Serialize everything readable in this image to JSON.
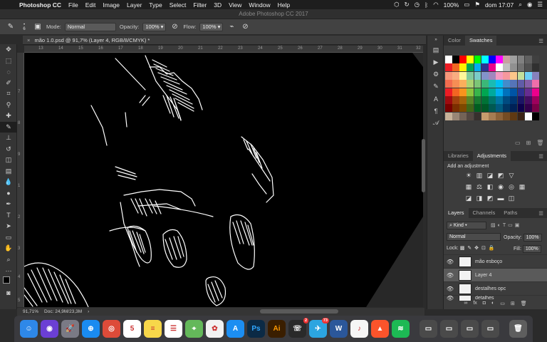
{
  "menubar": {
    "app_name": "Photoshop CC",
    "items": [
      "File",
      "Edit",
      "Image",
      "Layer",
      "Type",
      "Select",
      "Filter",
      "3D",
      "View",
      "Window",
      "Help"
    ],
    "battery": "100%",
    "clock": "dom 17:07"
  },
  "window_title": "Adobe Photoshop CC 2017",
  "options": {
    "brush_size": "6",
    "mode_label": "Mode:",
    "mode_value": "Normal",
    "opacity_label": "Opacity:",
    "opacity_value": "100%",
    "flow_label": "Flow:",
    "flow_value": "100%"
  },
  "document": {
    "tab_title": "mão 1.0.psd @ 91,7% (Layer 4, RGB/8/CMYK) *",
    "zoom": "91,71%",
    "doc_info": "Doc: 24,9M/23,3M"
  },
  "ruler": {
    "top": [
      "13",
      "14",
      "15",
      "16",
      "17",
      "18",
      "19",
      "20",
      "21",
      "22",
      "23",
      "24",
      "25",
      "26",
      "27",
      "28",
      "29",
      "30",
      "31",
      "32"
    ],
    "left": [
      "7",
      "8",
      "9",
      "1",
      "2",
      "3",
      "4",
      "5"
    ]
  },
  "panels": {
    "color_tabs": [
      "Color",
      "Swatches"
    ],
    "adjust_tabs": [
      "Libraries",
      "Adjustments"
    ],
    "adjust_title": "Add an adjustment",
    "layer_tabs": [
      "Layers",
      "Channels",
      "Paths"
    ],
    "kind_label": "Kind",
    "blend_mode": "Normal",
    "opacity_label": "Opacity:",
    "opacity_value": "100%",
    "lock_label": "Lock:",
    "fill_label": "Fill:",
    "fill_value": "100%",
    "layers": [
      {
        "name": "mão esboço",
        "selected": false
      },
      {
        "name": "Layer 4",
        "selected": true
      },
      {
        "name": "destalhes opc",
        "selected": false
      },
      {
        "name": "detalhes",
        "selected": false
      }
    ]
  },
  "swatches": [
    [
      "#ffffff",
      "#000000",
      "#ff0000",
      "#ffff00",
      "#00ff00",
      "#00ffff",
      "#0000ff",
      "#ff00ff",
      "#c8a0a0",
      "#a0a0a0",
      "#808080",
      "#606060",
      "#404040"
    ],
    [
      "#ed1c24",
      "#f26522",
      "#fff200",
      "#00a651",
      "#00aeef",
      "#2e3192",
      "#ec008c",
      "#ffffff",
      "#c0c0c0",
      "#909090",
      "#707070",
      "#505050",
      "#303030"
    ],
    [
      "#f7977a",
      "#f9ad81",
      "#fff79a",
      "#82ca9d",
      "#7accc8",
      "#8393ca",
      "#a187be",
      "#f49ac2",
      "#f6989d",
      "#fdc68a",
      "#c4df9b",
      "#6ecff6",
      "#8781bd"
    ],
    [
      "#f26c4f",
      "#f68e55",
      "#fbaf5c",
      "#acd372",
      "#7cc576",
      "#3bb878",
      "#1abbb4",
      "#00bff3",
      "#438ccb",
      "#5574b9",
      "#605ca8",
      "#855fa8",
      "#f06eaa"
    ],
    [
      "#ed1c24",
      "#f26522",
      "#f7941d",
      "#8dc63f",
      "#39b54a",
      "#00a651",
      "#00a99d",
      "#00aeef",
      "#0072bc",
      "#0054a6",
      "#2e3192",
      "#662d91",
      "#ec008c"
    ],
    [
      "#9e0b0f",
      "#a0410d",
      "#a3620a",
      "#598527",
      "#197b30",
      "#007236",
      "#00746b",
      "#0076a3",
      "#004b80",
      "#003471",
      "#1b1464",
      "#440e62",
      "#9e005d"
    ],
    [
      "#790000",
      "#7b2e00",
      "#7d4900",
      "#406618",
      "#005e20",
      "#005826",
      "#005952",
      "#005b7f",
      "#003663",
      "#002157",
      "#0d004c",
      "#32004b",
      "#7b0046"
    ],
    [
      "#c7b299",
      "#998675",
      "#736357",
      "#534741",
      "#37302d",
      "#c69c6d",
      "#a67c52",
      "#8c6239",
      "#754c24",
      "#603913",
      "#3c2415",
      "#ffffff",
      "#000000"
    ]
  ],
  "dock": {
    "apps": [
      {
        "name": "finder",
        "label": "☺",
        "color": "#2e88e8"
      },
      {
        "name": "siri",
        "label": "◉",
        "color": "#6b3fd4"
      },
      {
        "name": "launchpad",
        "label": "🚀",
        "color": "#7a7a85"
      },
      {
        "name": "safari",
        "label": "⊕",
        "color": "#1a8bf0"
      },
      {
        "name": "chrome",
        "label": "◎",
        "color": "#dd4b39"
      },
      {
        "name": "calendar",
        "label": "5",
        "color": "#ffffff"
      },
      {
        "name": "notes",
        "label": "≡",
        "color": "#f7d74a"
      },
      {
        "name": "reminders",
        "label": "☰",
        "color": "#ffffff"
      },
      {
        "name": "maps",
        "label": "⌖",
        "color": "#64b85a"
      },
      {
        "name": "photos",
        "label": "✿",
        "color": "#f2f2f2"
      },
      {
        "name": "app-store",
        "label": "A",
        "color": "#1c8ef2"
      },
      {
        "name": "photoshop",
        "label": "Ps",
        "color": "#0b2a45"
      },
      {
        "name": "illustrator",
        "label": "Ai",
        "color": "#3a1e00"
      },
      {
        "name": "whatsapp",
        "label": "☏",
        "color": "#2a2a2a"
      },
      {
        "name": "telegram",
        "label": "✈",
        "color": "#2ca5e0"
      },
      {
        "name": "word",
        "label": "W",
        "color": "#2b579a"
      },
      {
        "name": "music",
        "label": "♪",
        "color": "#f6f6f6"
      },
      {
        "name": "brave",
        "label": "▲",
        "color": "#fb542b"
      },
      {
        "name": "spotify",
        "label": "≋",
        "color": "#1db954"
      },
      {
        "name": "window-1",
        "label": "▭",
        "color": "#4a4a4a"
      },
      {
        "name": "window-2",
        "label": "▭",
        "color": "#4a4a4a"
      },
      {
        "name": "window-3",
        "label": "▭",
        "color": "#4a4a4a"
      },
      {
        "name": "window-4",
        "label": "▭",
        "color": "#4a4a4a"
      },
      {
        "name": "trash",
        "label": "🗑",
        "color": "#5e5e5e"
      }
    ],
    "telegram_badge": "73",
    "whatsapp_badge": "2",
    "calendar_day": "5"
  }
}
